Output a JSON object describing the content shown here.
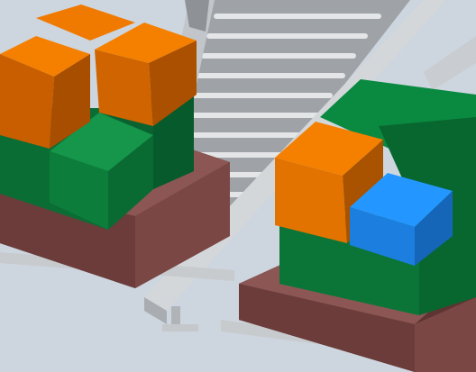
{
  "scene": {
    "description_type": "3D render of palletizing cell",
    "colors": {
      "floor": "#cdd5df",
      "conveyor_rail": "#c9cccf",
      "conveyor_roller": "#b7bbbf",
      "pallet": "#6a3a38",
      "box_green": "#0b7d3b",
      "box_orange": "#e07000",
      "box_blue": "#1e7fe0"
    },
    "objects": [
      {
        "name": "left-pallet",
        "kind": "pallet"
      },
      {
        "name": "right-pallet",
        "kind": "pallet"
      },
      {
        "name": "roller-conveyor",
        "kind": "conveyor"
      },
      {
        "name": "left-box-stack",
        "kind": "boxes",
        "count": 6
      },
      {
        "name": "right-box-stack",
        "kind": "boxes",
        "count": 3
      }
    ]
  }
}
